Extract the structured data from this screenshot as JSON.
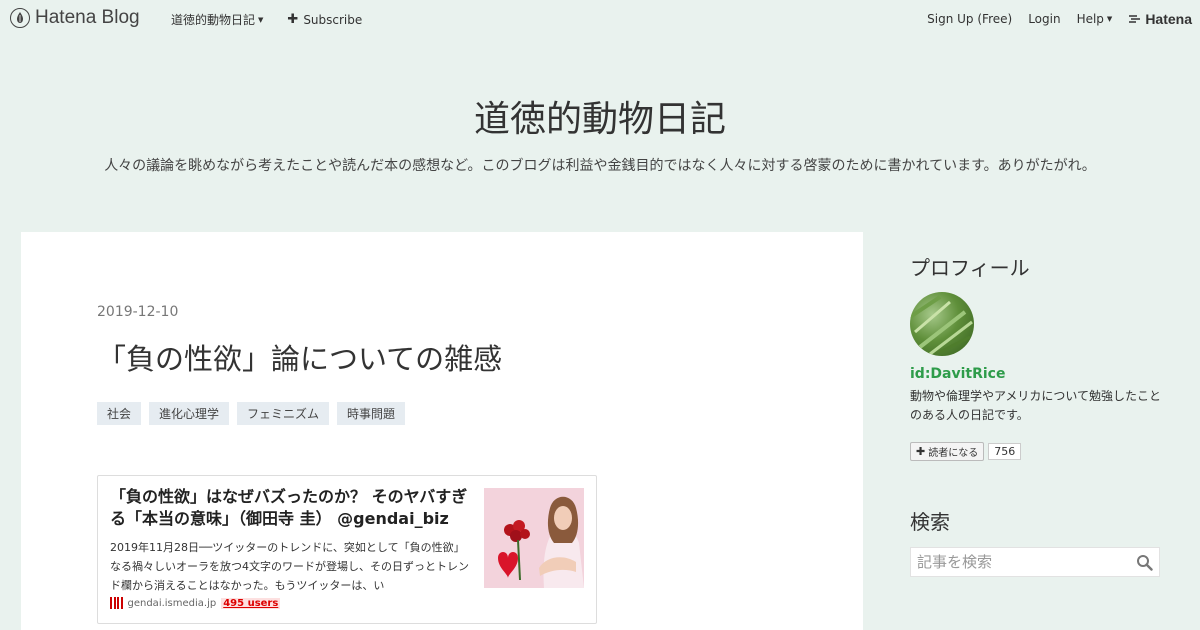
{
  "topbar": {
    "brand": "Hatena Blog",
    "blog_menu": "道徳的動物日記",
    "subscribe": "Subscribe",
    "signup": "Sign Up (Free)",
    "login": "Login",
    "help": "Help",
    "hatena": "Hatena"
  },
  "blog": {
    "title": "道徳的動物日記",
    "description": "人々の議論を眺めながら考えたことや読んだ本の感想など。このブログは利益や金銭目的ではなく人々に対する啓蒙のために書かれています。ありがたがれ。"
  },
  "post": {
    "date": "2019-12-10",
    "title": "「負の性欲」論についての雑感",
    "tags": [
      "社会",
      "進化心理学",
      "フェミニズム",
      "時事問題"
    ]
  },
  "embed": {
    "title": "「負の性欲」はなぜバズったのか？ そのヤバすぎる「本当の意味」（御田寺 圭） @gendai_biz",
    "description": "2019年11月28日──ツイッターのトレンドに、突如として「負の性欲」なる禍々しいオーラを放つ4文字のワードが登場し、その日ずっとトレンド欄から消えることはなかった。もうツイッターは、い",
    "source": "gendai.ismedia.jp",
    "users": "495 users"
  },
  "sidebar": {
    "profile_heading": "プロフィール",
    "profile_id": "id:DavitRice",
    "profile_desc": "動物や倫理学やアメリカについて勉強したことのある人の日記です。",
    "reader_label": "読者になる",
    "reader_count": "756",
    "search_heading": "検索",
    "search_placeholder": "記事を検索"
  },
  "colors": {
    "background": "#e9f2ee",
    "accent_green": "#2e9c4a",
    "users_red": "#dd0000"
  }
}
